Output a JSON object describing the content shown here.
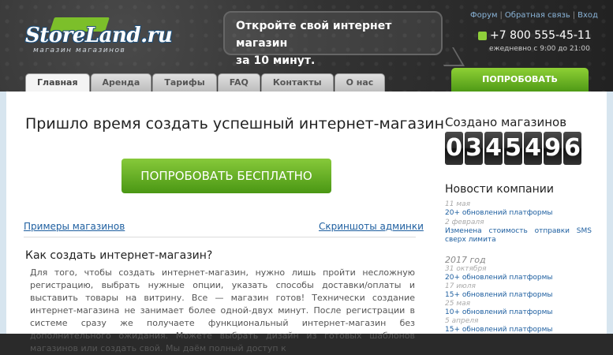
{
  "header": {
    "logo_text": "StoreLand.ru",
    "logo_sub": "магазин магазинов",
    "promo_line1": "Откройте свой интернет магазин",
    "promo_line2": "за 10 минут.",
    "top_links": [
      "Форум",
      "Обратная связь",
      "Вход"
    ],
    "phone": "+7 800 555-45-11",
    "hours": "ежедневно с 9:00 до 21:00",
    "cta": "ПОПРОБОВАТЬ БЕСПЛАТНО"
  },
  "nav": {
    "tabs": [
      "Главная",
      "Аренда",
      "Тарифы",
      "FAQ",
      "Контакты",
      "О нас"
    ],
    "active": "Главная"
  },
  "main": {
    "headline": "Пришло время создать успешный интернет-магазин",
    "cta": "ПОПРОБОВАТЬ БЕСПЛАТНО",
    "link_examples": "Примеры магазинов",
    "link_screens": "Скриншоты админки",
    "section_title": "Как создать интернет-магазин?",
    "paragraph": "Для того, чтобы создать интернет-магазин, нужно лишь пройти несложную регистрацию, выбрать нужные опции, указать способы доставки/оплаты и выставить товары на витрину. Все — магазин готов! Технически создание интернет-магазина не занимает более одной-двух минут. После регистрации в системе сразу же получаете функциональный интернет-магазин без дополнительного ожидания. Можете выбрать дизайн из готовых шаблонов магазинов или создать свой. Мы даём полный доступ к"
  },
  "sidebar": {
    "counter_title": "Создано магазинов",
    "counter_digits": [
      "0",
      "3",
      "4",
      "5",
      "4",
      "9",
      "6"
    ],
    "news_title": "Новости компании",
    "news": [
      {
        "date": "11 мая",
        "text": "20+ обновлений платформы"
      },
      {
        "date": "2 февраля",
        "text": "Изменена стоимость отправки SMS сверх лимита"
      }
    ],
    "year_label": "2017 год",
    "news_2017": [
      {
        "date": "31 октября",
        "text": "20+ обновлений платформы"
      },
      {
        "date": "17 июля",
        "text": "15+ обновлений платформы"
      },
      {
        "date": "25 мая",
        "text": "10+ обновлений платформы"
      },
      {
        "date": "5 апреля",
        "text": "15+ обновлений платформы"
      }
    ]
  }
}
